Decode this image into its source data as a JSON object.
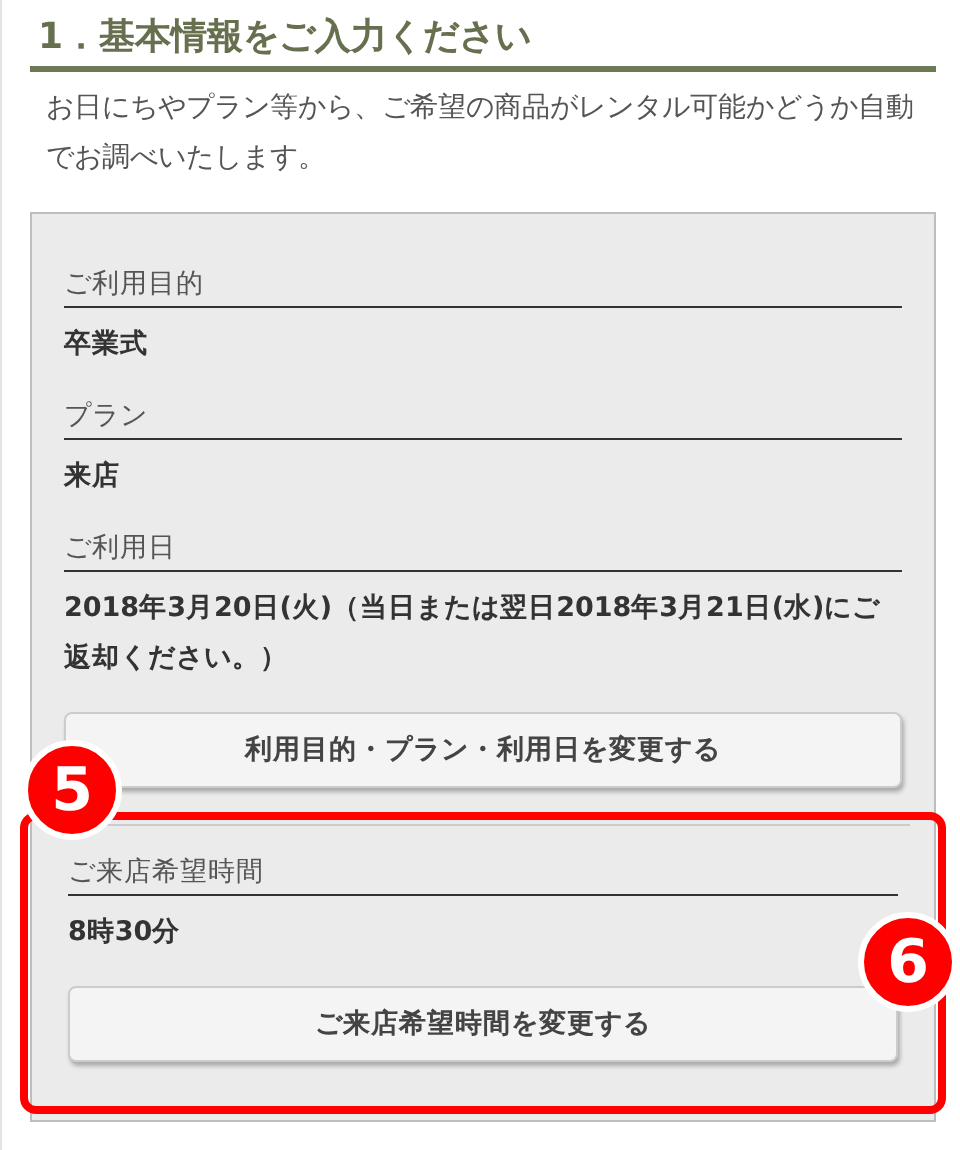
{
  "heading": "1．基本情報をご入力ください",
  "intro": "お日にちやプラン等から、ご希望の商品がレンタル可能かどうか自動でお調べいたします。",
  "fields": [
    {
      "label": "ご利用目的",
      "value": "卒業式"
    },
    {
      "label": "プラン",
      "value": "来店"
    },
    {
      "label": "ご利用日",
      "value": "2018年3月20日(火)（当日または翌日2018年3月21日(水)にご返却ください。）"
    }
  ],
  "change_button": "利用目的・プラン・利用日を変更する",
  "highlighted": {
    "badge": "5",
    "fields": [
      {
        "label": "ご来店希望時間",
        "value": "8時30分"
      }
    ],
    "button": "ご来店希望時間を変更する",
    "button_badge": "6"
  }
}
